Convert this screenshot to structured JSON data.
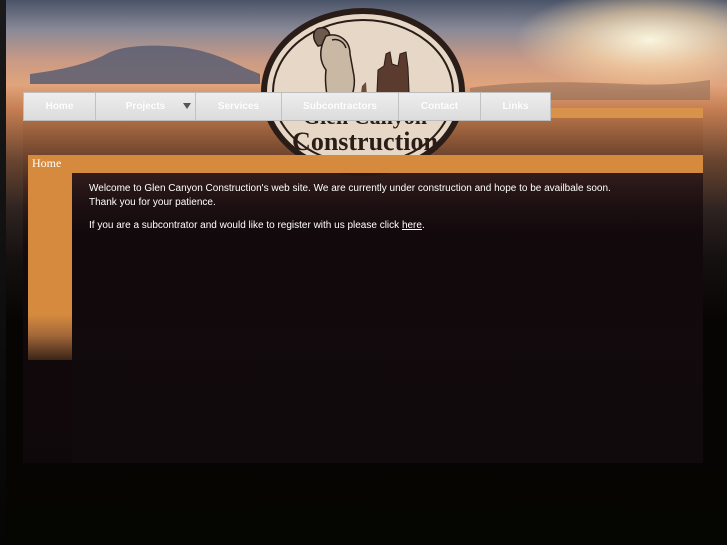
{
  "logo": {
    "line1": "Glen Canyon",
    "line2": "Construction"
  },
  "nav": {
    "items": [
      {
        "label": "Home"
      },
      {
        "label": "Projects"
      },
      {
        "label": "Services"
      },
      {
        "label": "Subcontractors"
      },
      {
        "label": "Contact"
      },
      {
        "label": "Links"
      }
    ],
    "projects_dropdown_icon": "triangle-down-icon"
  },
  "page": {
    "title": "Home"
  },
  "content": {
    "welcome_line1": "Welcome to Glen Canyon Construction's web site. We are currently under construction and hope to be availbale soon.",
    "welcome_line2": "Thank you for your patience.",
    "register_prefix": "If you are a subcontrator and would like to register with us please click ",
    "register_link": "here",
    "register_suffix": "."
  },
  "colors": {
    "accent_orange": "#d58a3e",
    "nav_bg": "#e4e4e4",
    "text": "#ffffff"
  }
}
